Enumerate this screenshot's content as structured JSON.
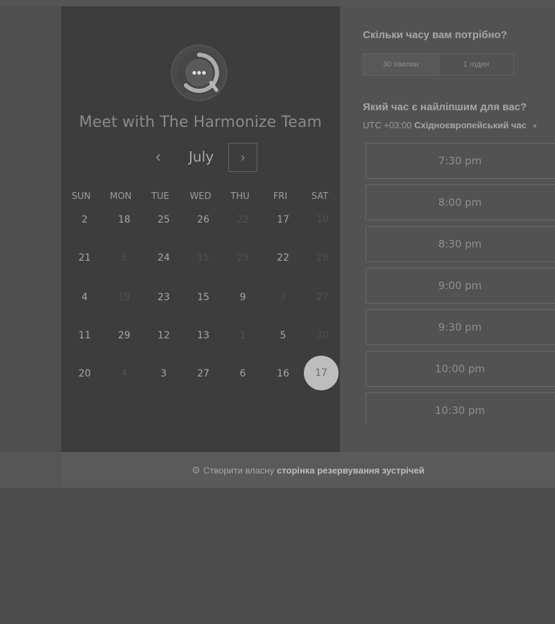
{
  "title": "Meet with The Harmonize Team",
  "calendar": {
    "month": "July",
    "prev_icon": "‹",
    "next_icon": "›",
    "weekdays": [
      "SUN",
      "MON",
      "TUE",
      "WED",
      "THU",
      "FRI",
      "SAT"
    ],
    "weeks": [
      [
        {
          "d": "2",
          "dim": false
        },
        {
          "d": "18",
          "dim": false
        },
        {
          "d": "25",
          "dim": false
        },
        {
          "d": "26",
          "dim": false
        },
        {
          "d": "22",
          "dim": true
        },
        {
          "d": "17",
          "dim": false
        },
        {
          "d": "10",
          "dim": true
        }
      ],
      [
        {
          "d": "21",
          "dim": false
        },
        {
          "d": "5",
          "dim": true
        },
        {
          "d": "24",
          "dim": false
        },
        {
          "d": "15",
          "dim": true
        },
        {
          "d": "29",
          "dim": true
        },
        {
          "d": "22",
          "dim": false
        },
        {
          "d": "28",
          "dim": true
        }
      ],
      [
        {
          "d": "4",
          "dim": false
        },
        {
          "d": "19",
          "dim": true
        },
        {
          "d": "23",
          "dim": false
        },
        {
          "d": "15",
          "dim": false
        },
        {
          "d": "9",
          "dim": false
        },
        {
          "d": "3",
          "dim": true
        },
        {
          "d": "27",
          "dim": true
        }
      ],
      [
        {
          "d": "11",
          "dim": false
        },
        {
          "d": "29",
          "dim": false
        },
        {
          "d": "12",
          "dim": false
        },
        {
          "d": "13",
          "dim": false
        },
        {
          "d": "1",
          "dim": true
        },
        {
          "d": "5",
          "dim": false
        },
        {
          "d": "30",
          "dim": true
        }
      ],
      [
        {
          "d": "20",
          "dim": false
        },
        {
          "d": "4",
          "dim": true
        },
        {
          "d": "3",
          "dim": false
        },
        {
          "d": "27",
          "dim": false
        },
        {
          "d": "6",
          "dim": false
        },
        {
          "d": "16",
          "dim": false
        },
        {
          "d": "17",
          "dim": false,
          "selected": true
        }
      ]
    ]
  },
  "duration": {
    "question": "Скільки часу вам потрібно?",
    "options": [
      "30 хвилин",
      "1 годин"
    ],
    "selected": "30 хвилин"
  },
  "time": {
    "question": "Який час є найліпшим для вас?",
    "tz_offset": "UTC +03:00",
    "tz_name": "Східноєвропейський час",
    "caret": "▼",
    "slots": [
      "7:30 pm",
      "8:00 pm",
      "8:30 pm",
      "9:00 pm",
      "9:30 pm",
      "10:00 pm",
      "10:30 pm"
    ]
  },
  "footer": {
    "icon": "sprocket-icon",
    "prefix": "Створити власну",
    "bold": "сторінка резервування зустрічей"
  }
}
